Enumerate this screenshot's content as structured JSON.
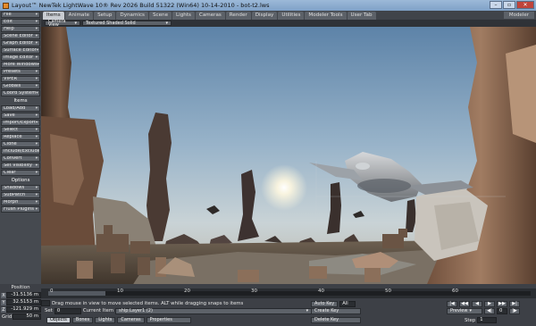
{
  "window": {
    "title": "Layout™ NewTek LightWave 10® Rev 2026 Build 51322 (Win64) 10-14-2010 - bot-t2.lws",
    "min": "–",
    "max": "▫",
    "close": "✕"
  },
  "tabs": [
    "Items",
    "Animate",
    "Setup",
    "Dynamics",
    "Scene",
    "Lights",
    "Cameras",
    "Render",
    "Display",
    "Utilities",
    "Modeler Tools",
    "User Tab"
  ],
  "modeler_button": "Modeler",
  "sidebar": {
    "top": [
      "File",
      "Edit",
      "Help",
      "Scene Editor",
      "Graph Editor",
      "Surface Editor",
      "Image Editor",
      "More Windows",
      "Presets",
      "VIPER",
      "Globals",
      "Coord System"
    ],
    "items_header": "Items",
    "items": [
      "Load/Add",
      "Save",
      "Import/Export",
      "Select",
      "Replace",
      "Clone",
      "Include/Exclude",
      "Convert",
      "Set Visibility",
      "Clear"
    ],
    "options_header": "Options",
    "options": [
      "Shadows",
      "SubPatch",
      "Morph",
      "Flush Plugins"
    ]
  },
  "viewport": {
    "view_mode": "Camera View",
    "render_mode": "Textured Shaded Solid"
  },
  "timeline": {
    "frames": [
      "0",
      "10",
      "20",
      "30",
      "40",
      "50",
      "60"
    ],
    "right_ticks": [
      "60",
      "60"
    ],
    "current_frame": "0"
  },
  "position": {
    "label": "Position",
    "x": "-31.5136 m",
    "y": "32.5153 m",
    "z": "-121.929 m",
    "grid_label": "Grid",
    "grid_value": "50 m"
  },
  "status_text": "Drag mouse in view to move selected items. ALT while dragging snaps to items",
  "controls": {
    "set_label": "Set",
    "set_value": "0",
    "current_item_label": "Current Item",
    "current_item_value": "ship:Layer1 (2)",
    "auto_key_label": "Auto Key",
    "auto_key_value": "All",
    "create_key": "Create Key",
    "delete_key": "Delete Key",
    "preview": "Preview",
    "step_label": "Step",
    "step_value": "1",
    "objects": "Objects",
    "bones": "Bones",
    "lights": "Lights",
    "cameras": "Cameras",
    "properties": "Properties"
  }
}
